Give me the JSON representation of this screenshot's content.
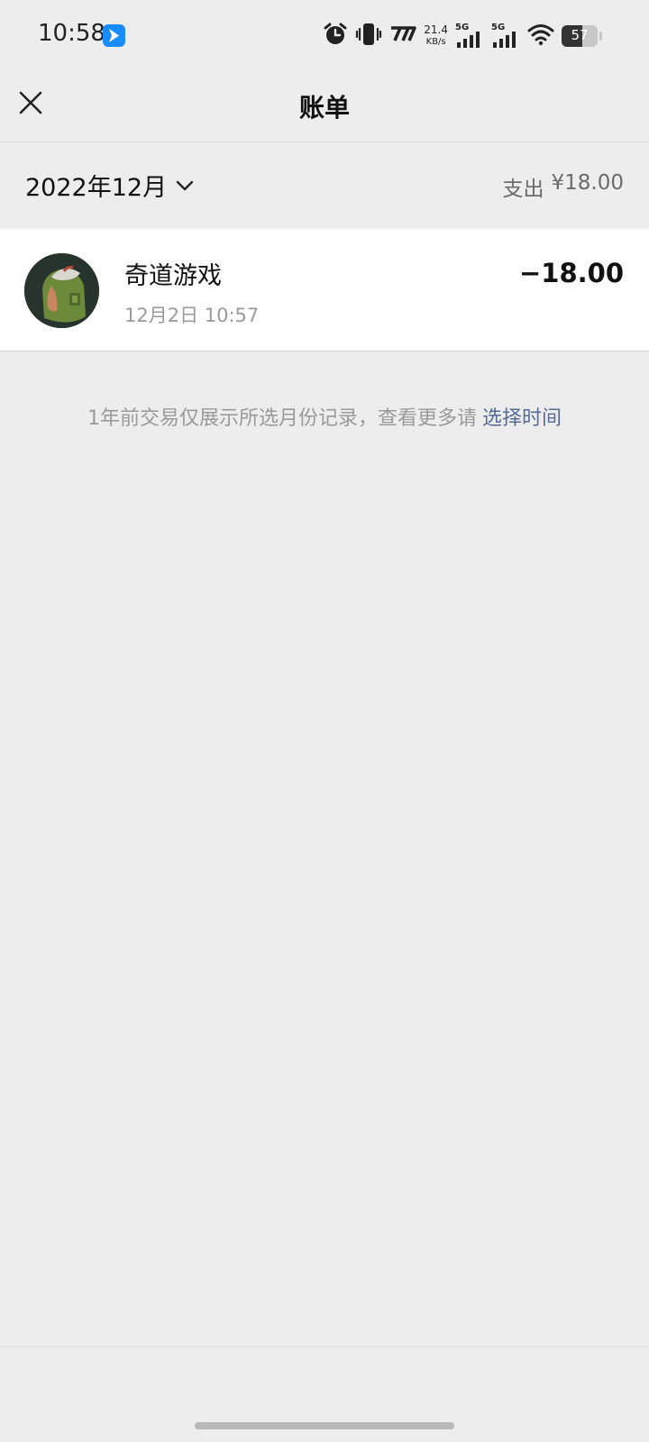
{
  "status_bar": {
    "time": "10:58",
    "net_speed_value": "21.4",
    "net_speed_unit": "KB/s",
    "sim1_label": "5G",
    "sim2_label": "5G",
    "battery": "57",
    "battery_level": 0.57,
    "app_icon": "feishu-app-icon"
  },
  "nav": {
    "title": "账单"
  },
  "month": {
    "label": "2022年12月",
    "summary_label": "支出",
    "summary_value": "¥18.00"
  },
  "transactions": [
    {
      "name": "奇道游戏",
      "time": "12月2日  10:57",
      "amount": "−18.00"
    }
  ],
  "notice": {
    "text": "1年前交易仅展示所选月份记录，查看更多请",
    "link": "选择时间"
  },
  "colors": {
    "background": "#ededed",
    "card": "#ffffff",
    "link": "#576b95",
    "muted": "#9a9a9a"
  }
}
